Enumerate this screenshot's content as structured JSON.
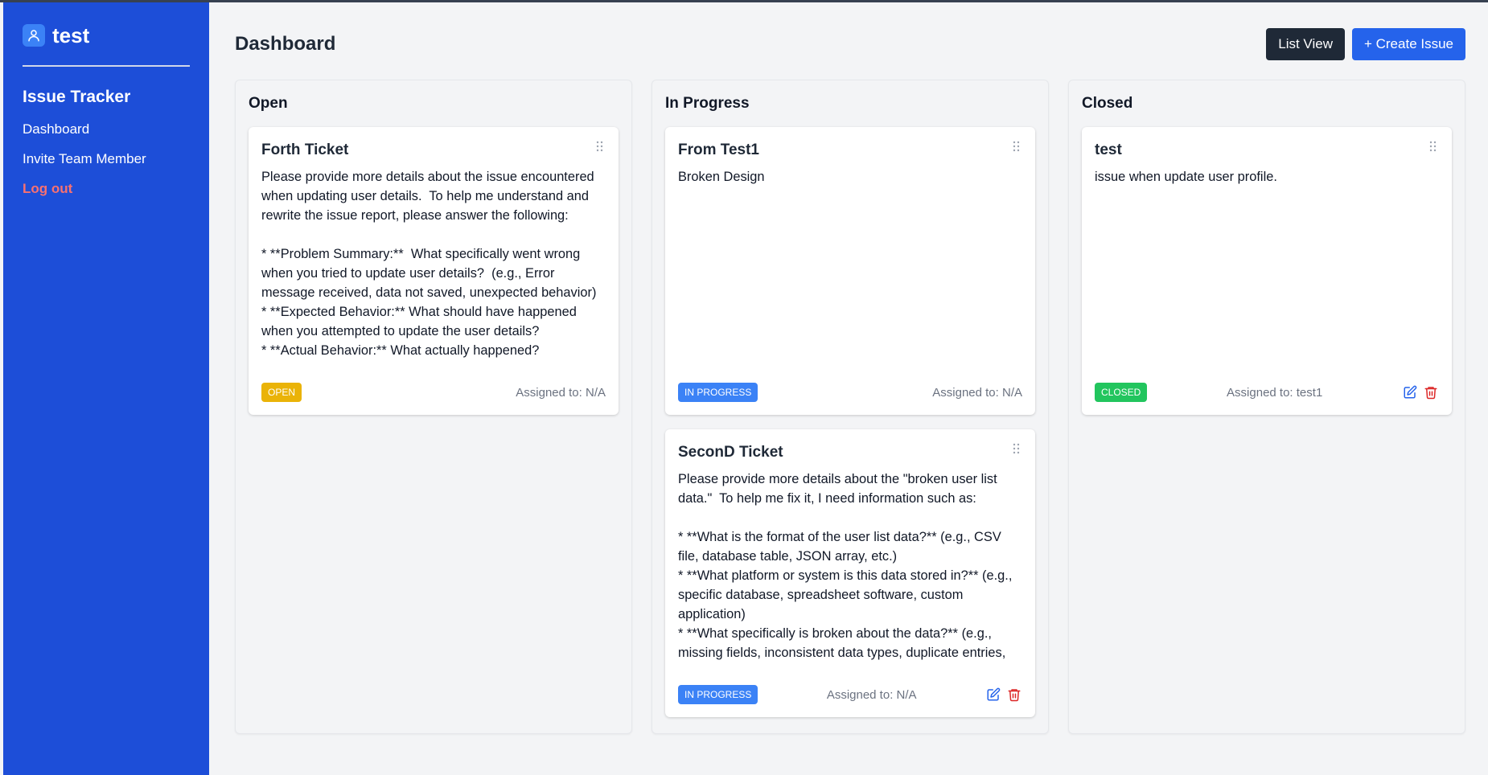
{
  "sidebar": {
    "brand": "test",
    "app_title": "Issue Tracker",
    "nav": [
      {
        "label": "Dashboard"
      },
      {
        "label": "Invite Team Member"
      },
      {
        "label": "Log out"
      }
    ]
  },
  "header": {
    "title": "Dashboard",
    "list_view_label": "List View",
    "create_label": "+ Create Issue"
  },
  "columns": [
    {
      "title": "Open",
      "cards": [
        {
          "title": "Forth Ticket",
          "description": "Please provide more details about the issue encountered when updating user details.  To help me understand and rewrite the issue report, please answer the following:\n\n* **Problem Summary:**  What specifically went wrong when you tried to update user details?  (e.g., Error message received, data not saved, unexpected behavior)\n* **Expected Behavior:** What should have happened when you attempted to update the user details?\n* **Actual Behavior:** What actually happened?\n* **Steps to Reproduce:** Please describe the exact steps",
          "status": "OPEN",
          "assigned": "Assigned to: N/A"
        }
      ]
    },
    {
      "title": "In Progress",
      "cards": [
        {
          "title": "From Test1",
          "description": "Broken Design",
          "status": "IN PROGRESS",
          "assigned": "Assigned to: N/A"
        },
        {
          "title": "SeconD Ticket",
          "description": "Please provide more details about the \"broken user list data.\"  To help me fix it, I need information such as:\n\n* **What is the format of the user list data?** (e.g., CSV file, database table, JSON array, etc.)\n* **What platform or system is this data stored in?** (e.g., specific database, spreadsheet software, custom application)\n* **What specifically is broken about the data?** (e.g., missing fields, inconsistent data types, duplicate entries, corrupted files, data integrity issues)",
          "status": "IN PROGRESS",
          "assigned": "Assigned to: N/A"
        }
      ]
    },
    {
      "title": "Closed",
      "cards": [
        {
          "title": "test",
          "description": "issue when update user profile.",
          "status": "CLOSED",
          "assigned": "Assigned to: test1"
        }
      ]
    }
  ],
  "colors": {
    "sidebar": "#1d4ed8",
    "open": "#eab308",
    "in_progress": "#3b82f6",
    "closed": "#22c55e",
    "delete": "#dc2626",
    "edit": "#2563eb"
  }
}
